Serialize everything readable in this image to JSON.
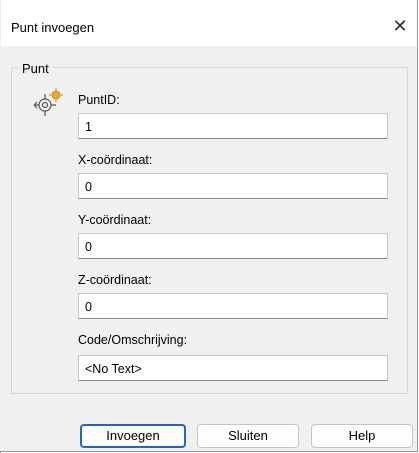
{
  "window": {
    "title": "Punt invoegen",
    "close_glyph": "✕"
  },
  "group": {
    "legend": "Punt",
    "icon": "point-insert-icon"
  },
  "fields": {
    "puntid": {
      "label": "PuntID:",
      "value": "1"
    },
    "x": {
      "label": "X-coördinaat:",
      "value": "0"
    },
    "y": {
      "label": "Y-coördinaat:",
      "value": "0"
    },
    "z": {
      "label": "Z-coördinaat:",
      "value": "0"
    },
    "code": {
      "label": "Code/Omschrijving:",
      "value": "<No Text>"
    }
  },
  "buttons": {
    "insert": "Invoegen",
    "close": "Sluiten",
    "help": "Help"
  },
  "colors": {
    "default_button_border": "#1f66c9",
    "icon_accent": "#f5a623"
  }
}
